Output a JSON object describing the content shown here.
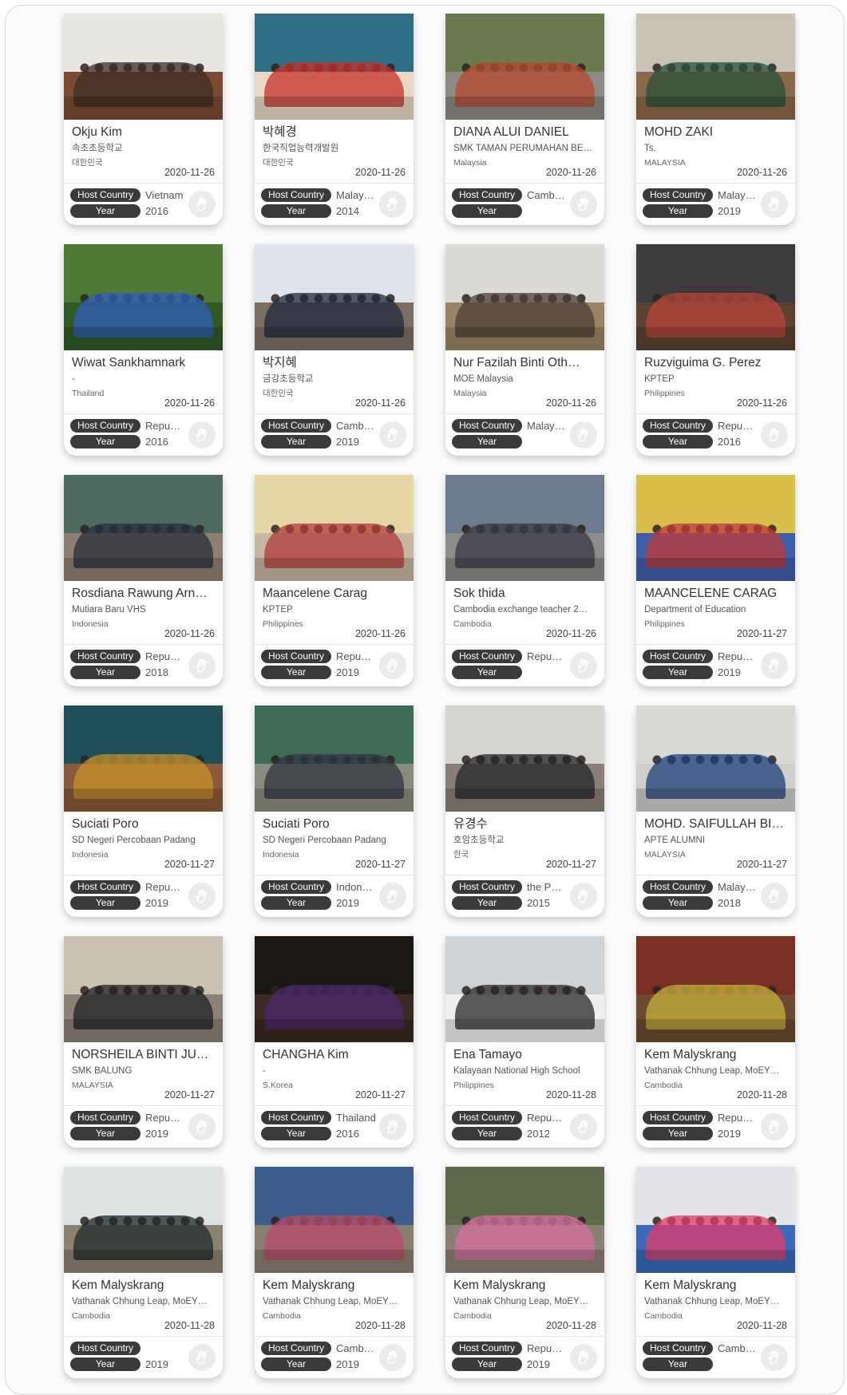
{
  "labels": {
    "host_country": "Host Country",
    "year": "Year"
  },
  "cards": [
    {
      "name": "Okju Kim",
      "org": "속초초등학교",
      "country": "대한민국",
      "date": "2020-11-26",
      "host": "Vietnam",
      "year": "2016",
      "photo": [
        "#e8e6e1",
        "#7a4a32",
        "#3c2c24"
      ]
    },
    {
      "name": "박혜경",
      "org": "한국직업능력개발원",
      "country": "대한민국",
      "date": "2020-11-26",
      "host": "Malaysia",
      "year": "2014",
      "photo": [
        "#2f6f86",
        "#e9d9c4",
        "#c4302b"
      ]
    },
    {
      "name": "DIANA ALUI DANIEL",
      "org": "SMK TAMAN PERUMAHAN BE…",
      "country": "Malaysia",
      "date": "2020-11-26",
      "host": "Cambo…",
      "year": "",
      "photo": [
        "#6b7a4e",
        "#8e8a86",
        "#b5492c"
      ]
    },
    {
      "name": "MOHD ZAKI",
      "org": "Ts.",
      "country": "MALAYSIA",
      "date": "2020-11-26",
      "host": "Malaysia",
      "year": "2019",
      "photo": [
        "#c9c2b6",
        "#8a6a4a",
        "#2a4f3b"
      ]
    },
    {
      "name": "Wiwat Sankhamnark",
      "org": "-",
      "country": "Thailand",
      "date": "2020-11-26",
      "host": "Republi…",
      "year": "2016",
      "photo": [
        "#4f7a35",
        "#2f5a24",
        "#2d5fb8"
      ]
    },
    {
      "name": "박지혜",
      "org": "금강초등학교",
      "country": "대한민국",
      "date": "2020-11-26",
      "host": "Cambo…",
      "year": "2019",
      "photo": [
        "#dfe4ea",
        "#7d6e63",
        "#1f2a3a"
      ]
    },
    {
      "name": "Nur Fazilah Binti Oth…",
      "org": "MOE Malaysia",
      "country": "Malaysia",
      "date": "2020-11-26",
      "host": "Malaysia",
      "year": "",
      "photo": [
        "#dcdad4",
        "#9a8466",
        "#4a3f38"
      ]
    },
    {
      "name": "Ruzviguima G. Perez",
      "org": "KPTEP",
      "country": "Philippines",
      "date": "2020-11-26",
      "host": "Republi…",
      "year": "2016",
      "photo": [
        "#3c3a3d",
        "#5a4030",
        "#b8453a"
      ]
    },
    {
      "name": "Rosdiana Rawung Arn…",
      "org": "Mutiara Baru VHS",
      "country": "Indonesia",
      "date": "2020-11-26",
      "host": "Republi…",
      "year": "2018",
      "photo": [
        "#4d6b5f",
        "#8f7e6e",
        "#27303e"
      ]
    },
    {
      "name": "Maancelene Carag",
      "org": "KPTEP",
      "country": "Philippines",
      "date": "2020-11-26",
      "host": "Republi…",
      "year": "2019",
      "photo": [
        "#e8d7a6",
        "#c8b8a2",
        "#b23b3b"
      ]
    },
    {
      "name": "Sok thida",
      "org": "Cambodia exchange teacher 2…",
      "country": "Cambodia",
      "date": "2020-11-26",
      "host": "Republi…",
      "year": "",
      "photo": [
        "#6d7c8d",
        "#8c8c8a",
        "#3a3a44"
      ]
    },
    {
      "name": "MAANCELENE CARAG",
      "org": "Department of Education",
      "country": "Philippines",
      "date": "2020-11-27",
      "host": "Republi…",
      "year": "2019",
      "photo": [
        "#d8c04a",
        "#3e5fa8",
        "#c23a3a"
      ]
    },
    {
      "name": "Suciati Poro",
      "org": "SD Negeri Percobaan Padang",
      "country": "Indonesia",
      "date": "2020-11-27",
      "host": "Republi…",
      "year": "2019",
      "photo": [
        "#1f4f59",
        "#8a5a3a",
        "#c7922b"
      ]
    },
    {
      "name": "Suciati Poro",
      "org": "SD Negeri Percobaan Padang",
      "country": "Indonesia",
      "date": "2020-11-27",
      "host": "Indone…",
      "year": "2019",
      "photo": [
        "#3d6b53",
        "#8b8b7d",
        "#2f3440"
      ]
    },
    {
      "name": "유경수",
      "org": "호암초등학교",
      "country": "한국",
      "date": "2020-11-27",
      "host": "the Phil…",
      "year": "2015",
      "photo": [
        "#d6d6d0",
        "#8a7f76",
        "#242428"
      ]
    },
    {
      "name": "MOHD. SAIFULLAH BI…",
      "org": "APTE ALUMNI",
      "country": "MALAYSIA",
      "date": "2020-11-27",
      "host": "Malaysia",
      "year": "2018",
      "photo": [
        "#d9d9d6",
        "#cfcfcc",
        "#1d3f7a"
      ]
    },
    {
      "name": "NORSHEILA BINTI JUL…",
      "org": "SMK BALUNG",
      "country": "MALAYSIA",
      "date": "2020-11-27",
      "host": "Republi…",
      "year": "2019",
      "photo": [
        "#c9c2b2",
        "#8a8276",
        "#202024"
      ]
    },
    {
      "name": "CHANGHA Kim",
      "org": "-",
      "country": "S.Korea",
      "date": "2020-11-27",
      "host": "Thailand",
      "year": "2016",
      "photo": [
        "#1a1612",
        "#3a2a22",
        "#4b2a6e"
      ]
    },
    {
      "name": "Ena Tamayo",
      "org": "Kalayaan National High School",
      "country": "Philippines",
      "date": "2020-11-28",
      "host": "Republi…",
      "year": "2012",
      "photo": [
        "#cfd3d6",
        "#efefee",
        "#2a2626"
      ]
    },
    {
      "name": "Kem Malyskrang",
      "org": "Vathanak Chhung Leap, MoEY…",
      "country": "Cambodia",
      "date": "2020-11-28",
      "host": "Republi…",
      "year": "2019",
      "photo": [
        "#7a2f24",
        "#6b4a30",
        "#c8b23c"
      ]
    },
    {
      "name": "Kem Malyskrang",
      "org": "Vathanak Chhung Leap, MoEY…",
      "country": "Cambodia",
      "date": "2020-11-28",
      "host": "",
      "year": "2019",
      "photo": [
        "#dfe2e2",
        "#8c8270",
        "#1f2a2a"
      ]
    },
    {
      "name": "Kem Malyskrang",
      "org": "Vathanak Chhung Leap, MoEY…",
      "country": "Cambodia",
      "date": "2020-11-28",
      "host": "Cambo…",
      "year": "2019",
      "photo": [
        "#3c5c8c",
        "#8a7e70",
        "#b84b6a"
      ]
    },
    {
      "name": "Kem Malyskrang",
      "org": "Vathanak Chhung Leap, MoEY…",
      "country": "Cambodia",
      "date": "2020-11-28",
      "host": "Republi…",
      "year": "2019",
      "photo": [
        "#5e6b4a",
        "#8b7f72",
        "#d86fa2"
      ]
    },
    {
      "name": "Kem Malyskrang",
      "org": "Vathanak Chhung Leap, MoEY…",
      "country": "Cambodia",
      "date": "2020-11-28",
      "host": "Cambo…",
      "year": "",
      "photo": [
        "#e2e4ea",
        "#3a6ab8",
        "#e23c6a"
      ]
    }
  ]
}
